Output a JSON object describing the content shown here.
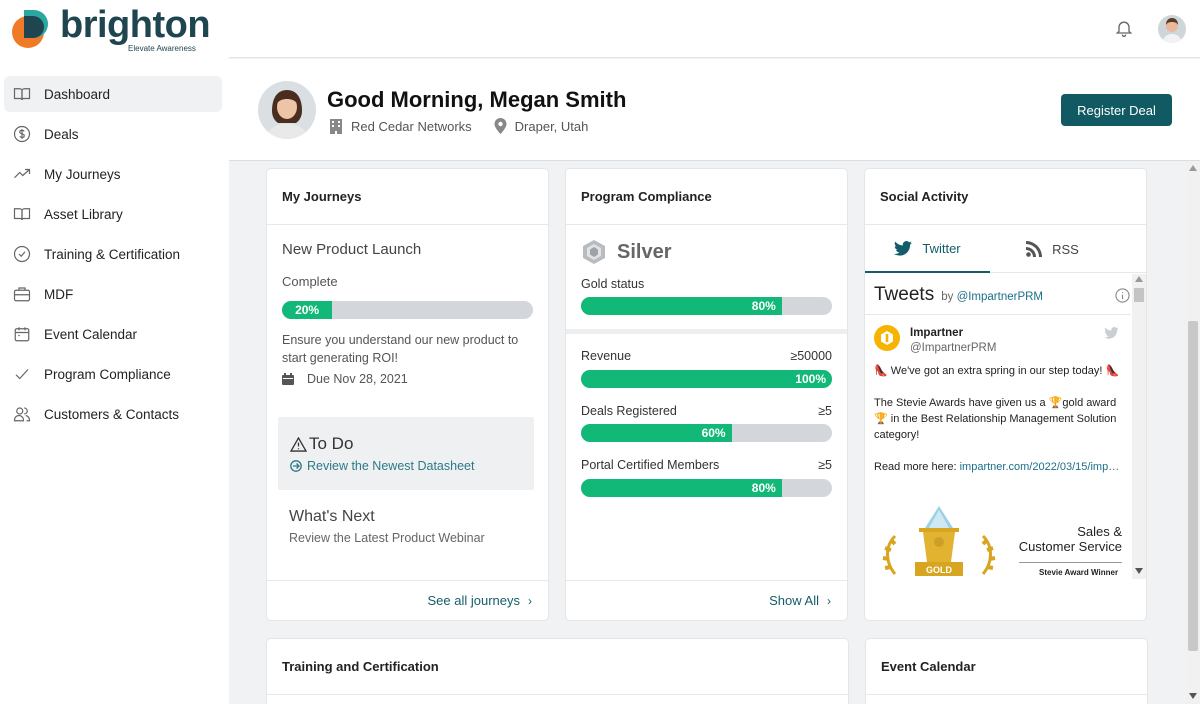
{
  "brand": {
    "name": "brighton",
    "tagline": "Elevate Awareness",
    "colors": {
      "dark": "#1f4650",
      "orange": "#f07a26",
      "teal": "#2aa7a1"
    }
  },
  "sidebar": {
    "items": [
      {
        "label": "Dashboard",
        "icon": "book-open-icon",
        "active": true
      },
      {
        "label": "Deals",
        "icon": "dollar-circle-icon"
      },
      {
        "label": "My Journeys",
        "icon": "trending-up-icon"
      },
      {
        "label": "Asset Library",
        "icon": "book-open-icon"
      },
      {
        "label": "Training & Certification",
        "icon": "check-circle-icon"
      },
      {
        "label": "MDF",
        "icon": "briefcase-icon"
      },
      {
        "label": "Event Calendar",
        "icon": "calendar-icon"
      },
      {
        "label": "Program Compliance",
        "icon": "check-icon"
      },
      {
        "label": "Customers & Contacts",
        "icon": "users-icon"
      }
    ]
  },
  "header": {
    "greeting": "Good Morning, Megan Smith",
    "company": "Red Cedar Networks",
    "location": "Draper, Utah",
    "register_label": "Register Deal",
    "accent": "#115a63"
  },
  "journeys": {
    "title": "My Journeys",
    "journey_name": "New Product Launch",
    "status": "Complete",
    "progress": 0.2,
    "progress_label": "20%",
    "description": "Ensure you understand our new product to start generating ROI!",
    "due": "Due Nov 28, 2021",
    "todo_title": "To Do",
    "todo_link": "Review the Newest Datasheet",
    "next_title": "What's Next",
    "next_text": "Review the Latest Product Webinar",
    "footer": "See all journeys"
  },
  "compliance": {
    "title": "Program Compliance",
    "level": "Silver",
    "gold_label": "Gold status",
    "gold_progress": 0.8,
    "gold_progress_label": "80%",
    "rows": [
      {
        "label": "Revenue",
        "target": "≥50000",
        "progress": 1.0,
        "progress_label": "100%"
      },
      {
        "label": "Deals Registered",
        "target": "≥5",
        "progress": 0.6,
        "progress_label": "60%"
      },
      {
        "label": "Portal Certified Members",
        "target": "≥5",
        "progress": 0.8,
        "progress_label": "80%"
      }
    ],
    "footer": "Show All"
  },
  "social": {
    "title": "Social Activity",
    "tabs": [
      "Twitter",
      "RSS"
    ],
    "feed_title": "Tweets",
    "feed_by": "by",
    "feed_handle": "@ImpartnerPRM",
    "tweet": {
      "name": "Impartner",
      "handle": "@ImpartnerPRM",
      "line1": "We've got an extra spring in our step today!",
      "line2a": "The Stevie Awards have given us a",
      "line2b": "gold award",
      "line2c": "in the Best Relationship Management Solution category!",
      "line3": "Read more here:",
      "link": "impartner.com/2022/03/15/imp…",
      "award_title_1": "Sales &",
      "award_title_2": "Customer Service",
      "award_sub": "Stevie Award Winner",
      "award_badge": "GOLD"
    }
  },
  "training": {
    "title": "Training and Certification"
  },
  "events": {
    "title": "Event Calendar"
  }
}
